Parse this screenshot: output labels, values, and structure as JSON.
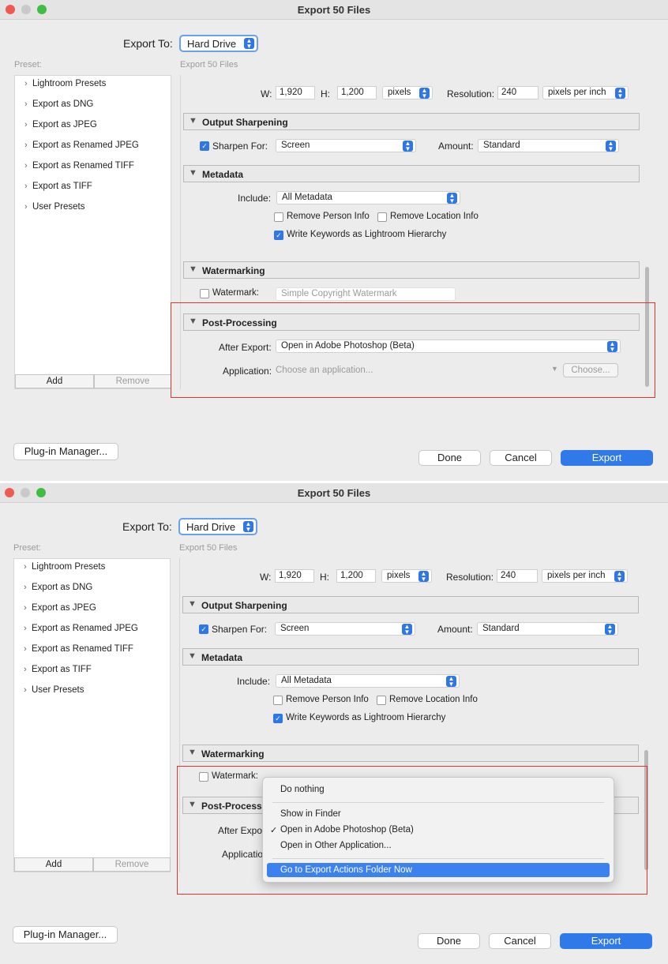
{
  "dialog": {
    "title": "Export 50 Files",
    "export_to_label": "Export To:",
    "export_to_value": "Hard Drive",
    "preset_label": "Preset:",
    "content_label": "Export 50 Files",
    "presets": [
      "Lightroom Presets",
      "Export as DNG",
      "Export as JPEG",
      "Export as Renamed JPEG",
      "Export as Renamed TIFF",
      "Export as TIFF",
      "User Presets"
    ],
    "add_label": "Add",
    "remove_label": "Remove",
    "plugin_manager_label": "Plug-in Manager...",
    "done_label": "Done",
    "cancel_label": "Cancel",
    "export_label": "Export"
  },
  "image_sizing": {
    "w_label": "W:",
    "w_value": "1,920",
    "h_label": "H:",
    "h_value": "1,200",
    "unit": "pixels",
    "resolution_label": "Resolution:",
    "resolution_value": "240",
    "resolution_unit": "pixels per inch"
  },
  "sharpening": {
    "title": "Output Sharpening",
    "sharpen_for_label": "Sharpen For:",
    "sharpen_for_value": "Screen",
    "amount_label": "Amount:",
    "amount_value": "Standard"
  },
  "metadata": {
    "title": "Metadata",
    "include_label": "Include:",
    "include_value": "All Metadata",
    "remove_person": "Remove Person Info",
    "remove_location": "Remove Location Info",
    "write_keywords": "Write Keywords as Lightroom Hierarchy"
  },
  "watermarking": {
    "title": "Watermarking",
    "watermark_label": "Watermark:",
    "watermark_value": "Simple Copyright Watermark"
  },
  "post_processing": {
    "title": "Post-Processing",
    "after_export_label": "After Export:",
    "after_export_value": "Open in Adobe Photoshop (Beta)",
    "application_label": "Application:",
    "application_placeholder": "Choose an application...",
    "choose_label": "Choose..."
  },
  "bottom": {
    "post_processing_partial": "Post-Processin",
    "after_export_partial": "After Expor",
    "application_partial": "Applicatio"
  },
  "after_export_menu": {
    "items": [
      "Do nothing",
      "Show in Finder",
      "Open in Adobe Photoshop (Beta)",
      "Open in Other Application...",
      "Go to Export Actions Folder Now"
    ],
    "checked": "Open in Adobe Photoshop (Beta)",
    "highlighted": "Go to Export Actions Folder Now"
  },
  "colors": {
    "accent": "#2f7ae8",
    "highlight_box": "#e23333"
  }
}
